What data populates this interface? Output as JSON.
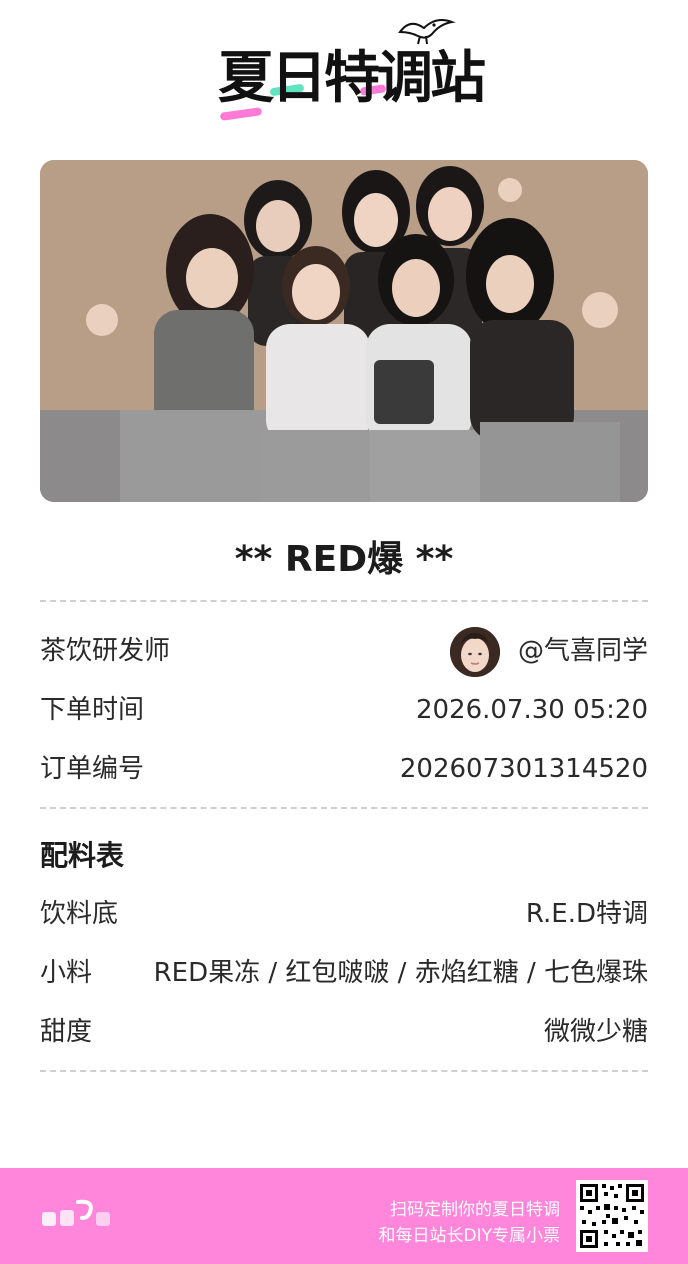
{
  "brand": {
    "logo_text": "夏日特调站"
  },
  "drink": {
    "title": "** RED爆 **"
  },
  "info": {
    "creator_label": "茶饮研发师",
    "creator_name": "@气喜同学",
    "time_label": "下单时间",
    "time_value": "2026.07.30  05:20",
    "order_label": "订单编号",
    "order_value": "202607301314520"
  },
  "recipe": {
    "title": "配料表",
    "base_label": "饮料底",
    "base_value": "R.E.D特调",
    "toppings_label": "小料",
    "toppings_value": "RED果冻 / 红包啵啵 / 赤焰红糖 / 七色爆珠",
    "sweetness_label": "甜度",
    "sweetness_value": "微微少糖"
  },
  "footer": {
    "line1": "扫码定制你的夏日特调",
    "line2": "和每日站长DIY专属小票"
  },
  "colors": {
    "footer_bg": "#ff86da",
    "accent_green": "#5fe3c0",
    "divider": "#cfcfcf"
  }
}
